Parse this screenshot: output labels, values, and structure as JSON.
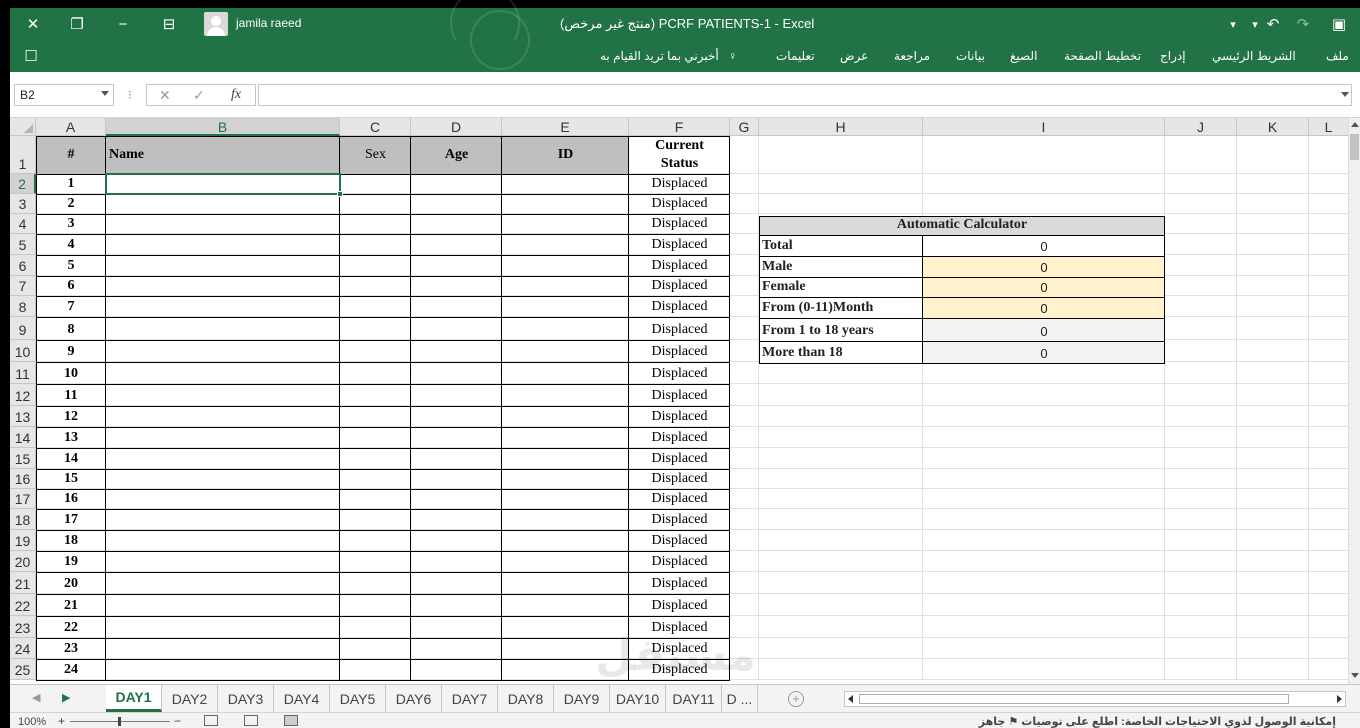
{
  "window": {
    "user_name": "jamila raeed",
    "doc_title": "PCRF PATIENTS-1  -  Excel",
    "doc_title_rtl": "(منتج غير مرخص)"
  },
  "ribbon": {
    "tabs": [
      "ملف",
      "الشريط الرئيسي",
      "إدراج",
      "تخطيط الصفحة",
      "الصيغ",
      "بيانات",
      "مراجعة",
      "عرض",
      "تعليمات"
    ],
    "tell_me": "أخبرني بما تريد القيام به"
  },
  "formula_bar": {
    "name_box": "B2",
    "separator": "⁝",
    "cancel": "✕",
    "enter": "✓",
    "fx": "fx",
    "value": ""
  },
  "grid": {
    "columns": [
      "A",
      "B",
      "C",
      "D",
      "E",
      "F",
      "G",
      "H",
      "I",
      "J",
      "K",
      "L"
    ],
    "selected_column": "B",
    "selected_row": "2",
    "rows": [
      "1",
      "2",
      "3",
      "4",
      "5",
      "6",
      "7",
      "8",
      "9",
      "10",
      "11",
      "12",
      "13",
      "14",
      "15",
      "16",
      "17",
      "18",
      "19",
      "20",
      "21",
      "22",
      "23",
      "24",
      "25"
    ]
  },
  "table": {
    "headers": {
      "num": "#",
      "name": "Name",
      "sex": "Sex",
      "age": "Age",
      "id": "ID",
      "status_line1": "Current",
      "status_line2": "Status"
    },
    "row_numbers": [
      "1",
      "2",
      "3",
      "4",
      "5",
      "6",
      "7",
      "8",
      "9",
      "10",
      "11",
      "12",
      "13",
      "14",
      "15",
      "16",
      "17",
      "18",
      "19",
      "20",
      "21",
      "22",
      "23",
      "24"
    ],
    "status_value": "Displaced"
  },
  "calculator": {
    "title": "Automatic Calculator",
    "rows": [
      {
        "label": "Total",
        "value": "0"
      },
      {
        "label": "Male",
        "value": "0"
      },
      {
        "label": "Female",
        "value": "0"
      },
      {
        "label": "From (0-11)Month",
        "value": "0"
      },
      {
        "label": "From 1 to 18 years",
        "value": "0"
      },
      {
        "label": "More than 18",
        "value": "0"
      }
    ],
    "colors": {
      "header_bg": "#d9d9d9",
      "male_bg": "#fff2cc",
      "female_bg": "#fff2cc",
      "infant_bg": "#fff2cc",
      "child_bg": "#f2f2f2",
      "adult_bg": "#f2f2f2"
    }
  },
  "sheets": {
    "tabs": [
      "DAY1",
      "DAY2",
      "DAY3",
      "DAY4",
      "DAY5",
      "DAY6",
      "DAY7",
      "DAY8",
      "DAY9",
      "DAY10",
      "DAY11",
      "D ..."
    ],
    "active": "DAY1"
  },
  "status_bar": {
    "zoom": "100%",
    "minus": "−",
    "plus": "+",
    "message": "إمكانية الوصول لذوي الاحتياجات الخاصة: اطلع على توصيات",
    "ready": "جاهز"
  },
  "colors": {
    "accent": "#217346",
    "table_header": "#bfbfbf"
  },
  "watermark": "مستقل"
}
